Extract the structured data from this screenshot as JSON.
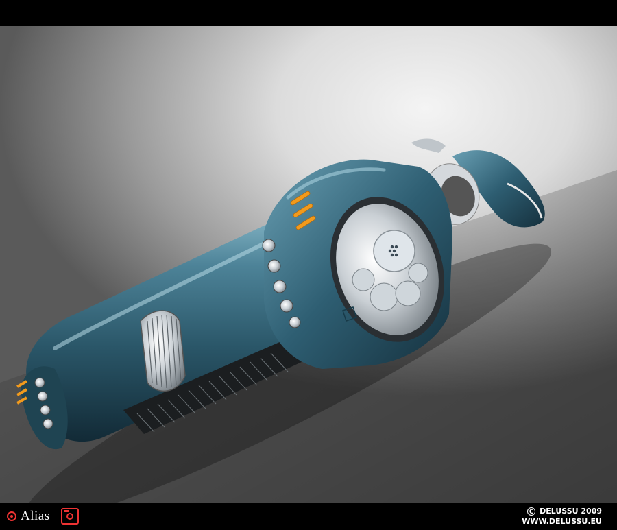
{
  "footer": {
    "software_name": "Alias",
    "software_icon": "alias-logo-icon",
    "camera_icon": "camera-icon",
    "copyright_symbol": "C",
    "copyright_line": "DELUSSU  2009",
    "website": "WWW.DELUSSU.EU"
  },
  "colors": {
    "body_teal": "#2c5a6e",
    "body_highlight": "#6fa2b5",
    "accent_orange": "#f29a1c",
    "chrome": "#c8ccd0",
    "background_light": "#f0f0f0",
    "background_dark": "#555555"
  }
}
